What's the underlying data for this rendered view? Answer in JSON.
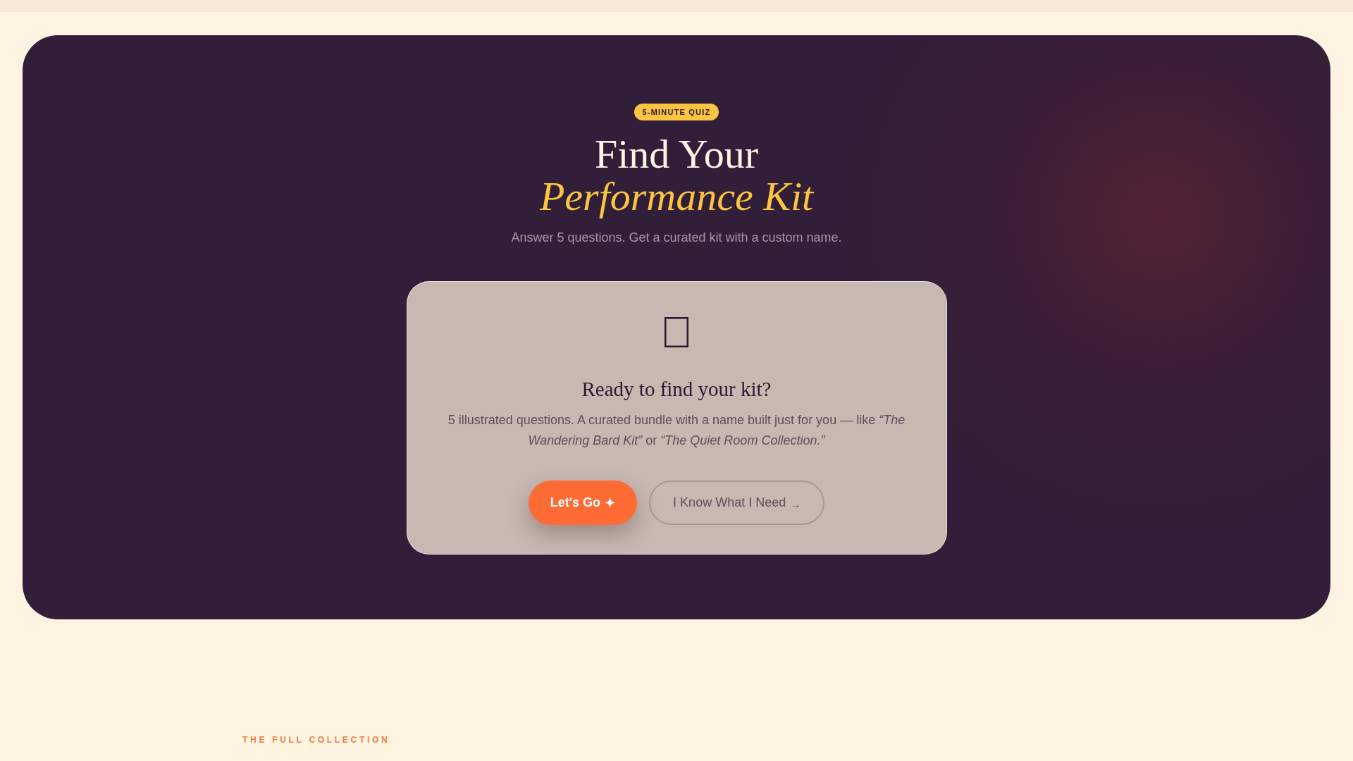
{
  "hero": {
    "badge": "5-MINUTE QUIZ",
    "title": "Find Your",
    "title_accent": "Performance Kit",
    "subtitle": "Answer 5 questions. Get a curated kit with a custom name.",
    "card": {
      "heading": "Ready to find your kit?",
      "text": "5 illustrated questions. A curated bundle with a name built just for you — like *“The Wandering Bard Kit”* or *“The Quiet Room Collection.”*",
      "buttons": [
        {
          "kind": "primary",
          "label": "Let's Go",
          "glyph": "✦"
        },
        {
          "kind": "secondary",
          "label": "I Know What I Need",
          "glyph": "→"
        }
      ]
    }
  },
  "collection": {
    "eyebrow": "THE FULL COLLECTION"
  }
}
